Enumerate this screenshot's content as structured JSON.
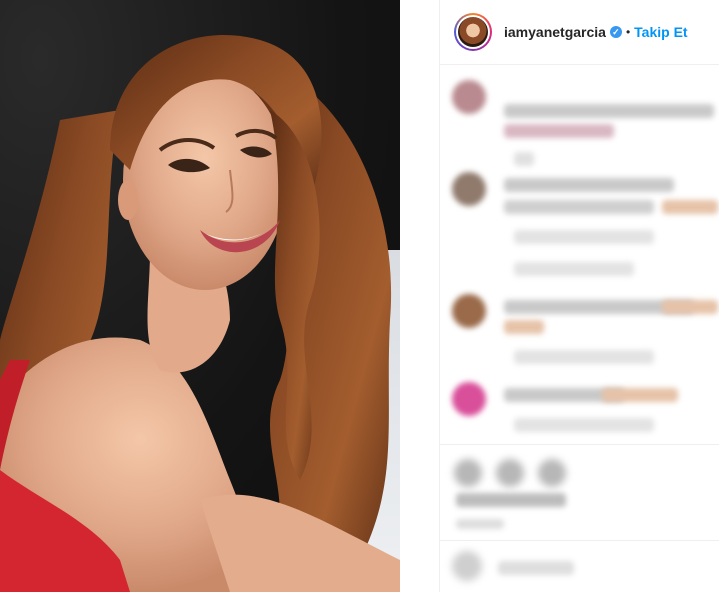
{
  "post": {
    "username": "iamyanetgarcia",
    "verified_glyph": "✓",
    "separator": "•",
    "follow_label": "Takip Et"
  },
  "colors": {
    "follow_blue": "#0095f6",
    "verified_blue": "#3897f0",
    "dress_red": "#d32630",
    "hair_brown": "#7a3f1f"
  },
  "icons": [
    "verified-icon",
    "like-icon",
    "comment-icon",
    "share-icon",
    "emoji-icon"
  ]
}
